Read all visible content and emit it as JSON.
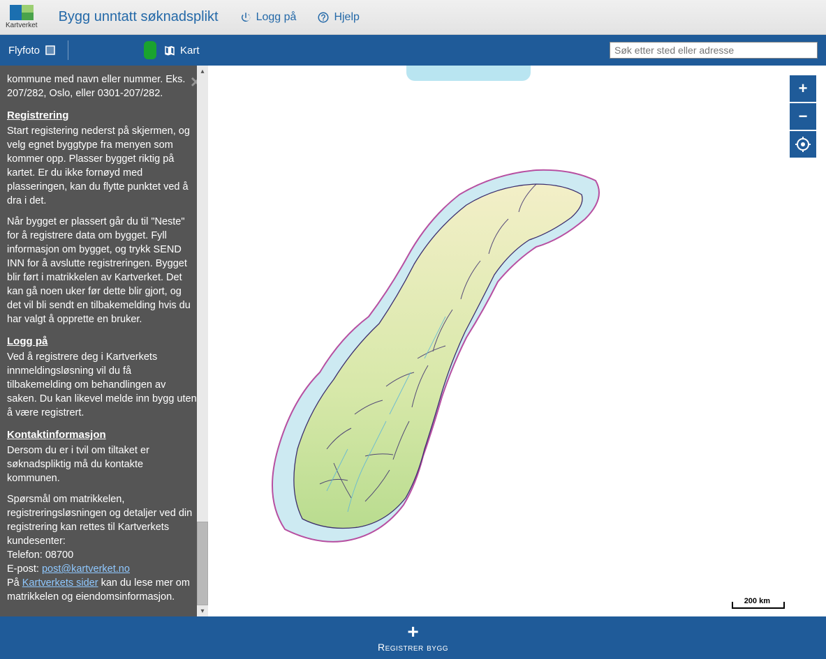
{
  "header": {
    "logo_caption": "Kartverket",
    "app_title": "Bygg unntatt søknadsplikt",
    "login_label": "Logg på",
    "help_label": "Hjelp"
  },
  "toolbar": {
    "flyfoto_label": "Flyfoto",
    "kart_label": "Kart",
    "search_placeholder": "Søk etter sted eller adresse"
  },
  "sidebar": {
    "intro_fragment": "kommune med navn eller nummer. Eks. 207/282, Oslo, eller 0301-207/282.",
    "h_reg": "Registrering",
    "p_reg_1": "Start registering nederst på skjermen, og velg egnet byggtype fra menyen som kommer opp. Plasser bygget riktig på kartet. Er du ikke fornøyd med plasseringen, kan du flytte punktet ved å dra i det.",
    "p_reg_2": "Når bygget er plassert går du til \"Neste\" for å registrere data om bygget. Fyll informasjon om bygget, og trykk SEND INN for å avslutte registreringen. Bygget blir ført i matrikkelen av Kartverket. Det kan gå noen uker før dette blir gjort, og det vil bli sendt en tilbakemelding hvis du har valgt å opprette en bruker.",
    "h_login": "Logg på",
    "p_login": "Ved å registrere deg i Kartverkets innmeldingsløsning vil du få tilbakemelding om behandlingen av saken. Du kan likevel melde inn bygg uten å være registrert.",
    "h_contact": "Kontaktinformasjon",
    "p_contact_1": "Dersom du er i tvil om tiltaket er søknadspliktig må du kontakte kommunen.",
    "p_contact_2_a": "Spørsmål om matrikkelen, registreringsløsningen og detaljer ved din registrering kan rettes til Kartverkets kundesenter:",
    "p_contact_phone": "Telefon: 08700",
    "p_contact_email_label": "E-post: ",
    "p_contact_email_link": "post@kartverket.no",
    "p_contact_3_a": "På ",
    "p_contact_3_link": "Kartverkets sider",
    "p_contact_3_b": " kan du lese mer om matrikkelen og eiendomsinformasjon."
  },
  "map": {
    "scale_label": "200 km"
  },
  "footer": {
    "register_label": "Registrer bygg"
  }
}
